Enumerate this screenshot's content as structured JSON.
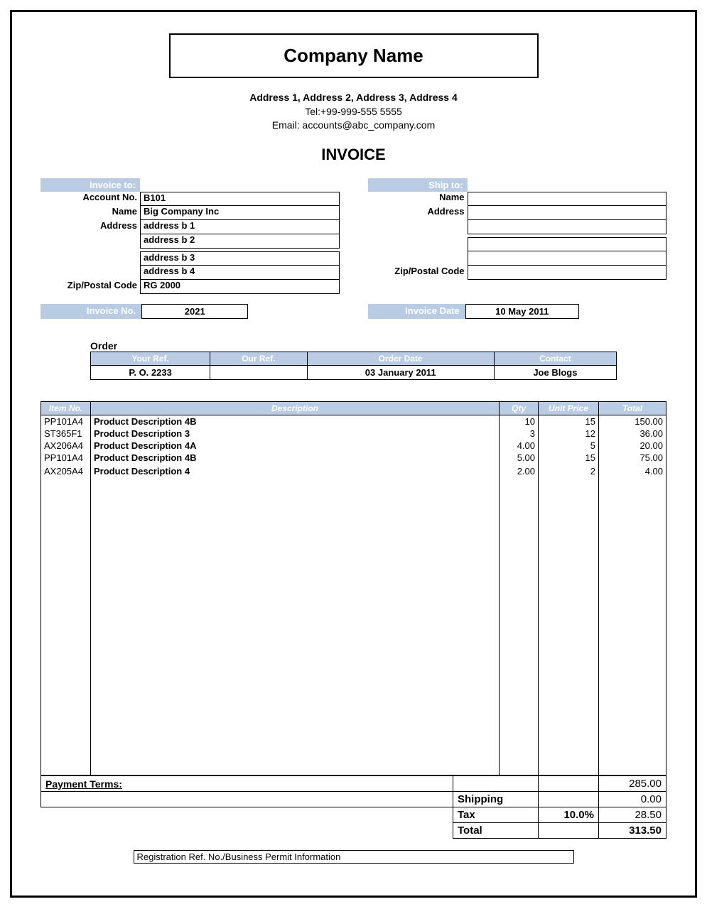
{
  "company": {
    "name": "Company Name",
    "address_line": "Address 1, Address 2, Address 3, Address 4",
    "tel": "Tel:+99-999-555 5555",
    "email": "Email: accounts@abc_company.com"
  },
  "doc_title": "INVOICE",
  "invoice_to": {
    "header": "Invoice to:",
    "labels": {
      "account_no": "Account No.",
      "name": "Name",
      "address": "Address",
      "zip": "Zip/Postal Code"
    },
    "account_no": "B101",
    "name": "Big Company Inc",
    "address1": "address b 1",
    "address2": "address b 2",
    "address3": "address b 3",
    "address4": "address b 4",
    "zip": "RG 2000"
  },
  "ship_to": {
    "header": "Ship to:",
    "labels": {
      "name": "Name",
      "address": "Address",
      "zip": "Zip/Postal Code"
    },
    "name": "",
    "address1": "",
    "address2": "",
    "address3": "",
    "address4": "",
    "zip": ""
  },
  "invoice_meta": {
    "no_label": "Invoice No.",
    "no": "2021",
    "date_label": "Invoice Date",
    "date": "10 May 2011"
  },
  "order": {
    "title": "Order",
    "headers": {
      "your_ref": "Your Ref.",
      "our_ref": "Our Ref.",
      "order_date": "Order Date",
      "contact": "Contact"
    },
    "your_ref": "P. O. 2233",
    "our_ref": "",
    "order_date": "03 January 2011",
    "contact": "Joe Blogs"
  },
  "items": {
    "headers": {
      "item_no": "Item No.",
      "description": "Description",
      "qty": "Qty",
      "unit_price": "Unit Price",
      "total": "Total"
    },
    "rows": [
      {
        "item_no": "PP101A4",
        "description": "Product Description 4B",
        "qty": "10",
        "unit_price": "15",
        "total": "150.00"
      },
      {
        "item_no": "ST365F1",
        "description": "Product Description 3",
        "qty": "3",
        "unit_price": "12",
        "total": "36.00"
      },
      {
        "item_no": "AX206A4",
        "description": "Product Description 4A",
        "qty": "4.00",
        "unit_price": "5",
        "total": "20.00"
      },
      {
        "item_no": "PP101A4",
        "description": "Product Description 4B",
        "qty": "5.00",
        "unit_price": "15",
        "total": "75.00"
      },
      {
        "item_no": "",
        "description": "",
        "qty": "",
        "unit_price": "",
        "total": ""
      },
      {
        "item_no": "AX205A4",
        "description": "Product Description 4",
        "qty": "2.00",
        "unit_price": "2",
        "total": "4.00"
      }
    ]
  },
  "summary": {
    "payment_terms_label": "Payment Terms:",
    "subtotal": "285.00",
    "shipping_label": "Shipping",
    "shipping": "0.00",
    "tax_label": "Tax",
    "tax_rate": "10.0%",
    "tax": "28.50",
    "total_label": "Total",
    "total": "313.50"
  },
  "footer": "Registration Ref. No./Business Permit Information"
}
